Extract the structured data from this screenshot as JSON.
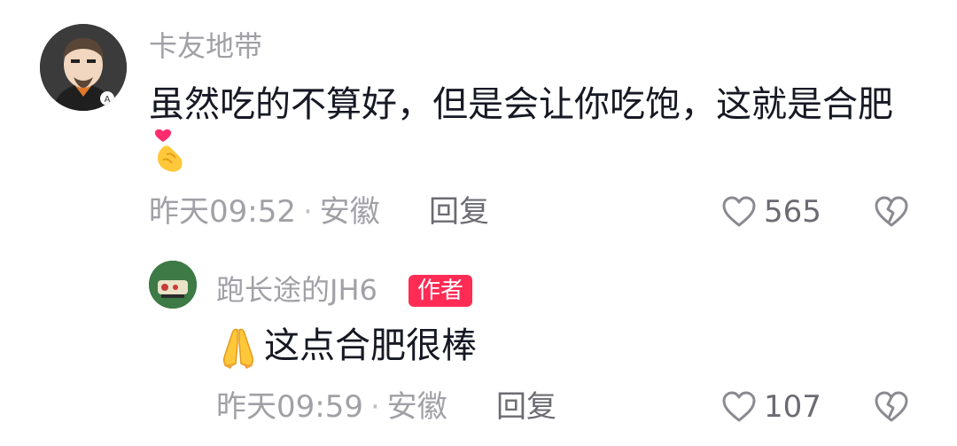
{
  "comment": {
    "username": "卡友地带",
    "text": "虽然吃的不算好，但是会让你吃饱，这就是合肥",
    "emoji_icon": "heart-hand-emoji",
    "time": "昨天09:52",
    "location": "安徽",
    "separator": "·",
    "reply_label": "回复",
    "likes": "565"
  },
  "reply": {
    "username": "跑长途的JH6",
    "author_badge": "作者",
    "emoji_icon": "pray-emoji",
    "text": "这点合肥很棒",
    "time": "昨天09:59",
    "location": "安徽",
    "separator": "·",
    "reply_label": "回复",
    "likes": "107"
  },
  "colors": {
    "username": "#a0a0a6",
    "text": "#161823",
    "badge": "#fe2c55"
  }
}
